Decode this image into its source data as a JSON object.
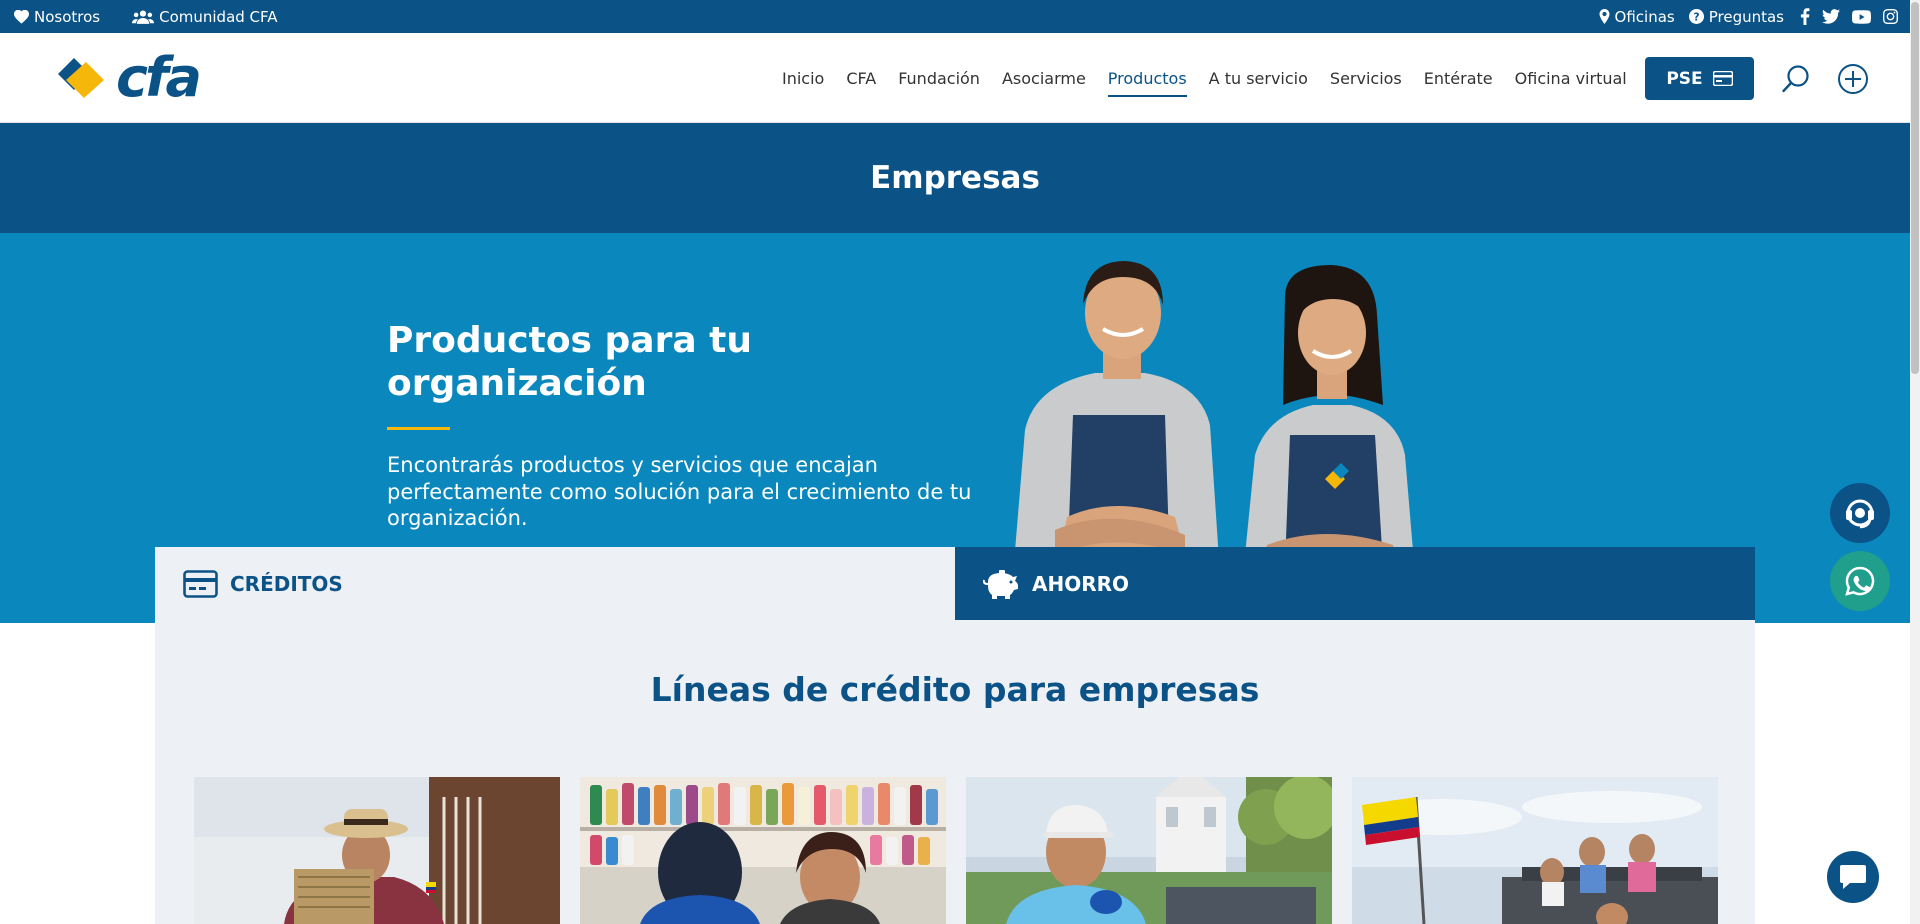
{
  "topbar": {
    "nosotros": "Nosotros",
    "comunidad": "Comunidad CFA",
    "oficinas": "Oficinas",
    "preguntas": "Preguntas"
  },
  "header": {
    "logo_text": "cfa",
    "nav": [
      "Inicio",
      "CFA",
      "Fundación",
      "Asociarme",
      "Productos",
      "A tu servicio",
      "Servicios",
      "Entérate",
      "Oficina virtual"
    ],
    "active_nav": "Productos",
    "pse_label": "PSE"
  },
  "page": {
    "title": "Empresas"
  },
  "hero": {
    "heading": "Productos para tu organización",
    "text": "Encontrarás productos y servicios que encajan perfectamente como solución para el crecimiento de tu organización."
  },
  "tabs": {
    "creditos": "CRÉDITOS",
    "ahorro": "AHORRO",
    "active": "CRÉDITOS"
  },
  "section": {
    "title": "Líneas de crédito para empresas"
  },
  "colors": {
    "primary": "#0b5287",
    "hero_bg": "#0a88bd",
    "accent_yellow": "#f5b70a",
    "whatsapp": "#1f9f8c"
  }
}
